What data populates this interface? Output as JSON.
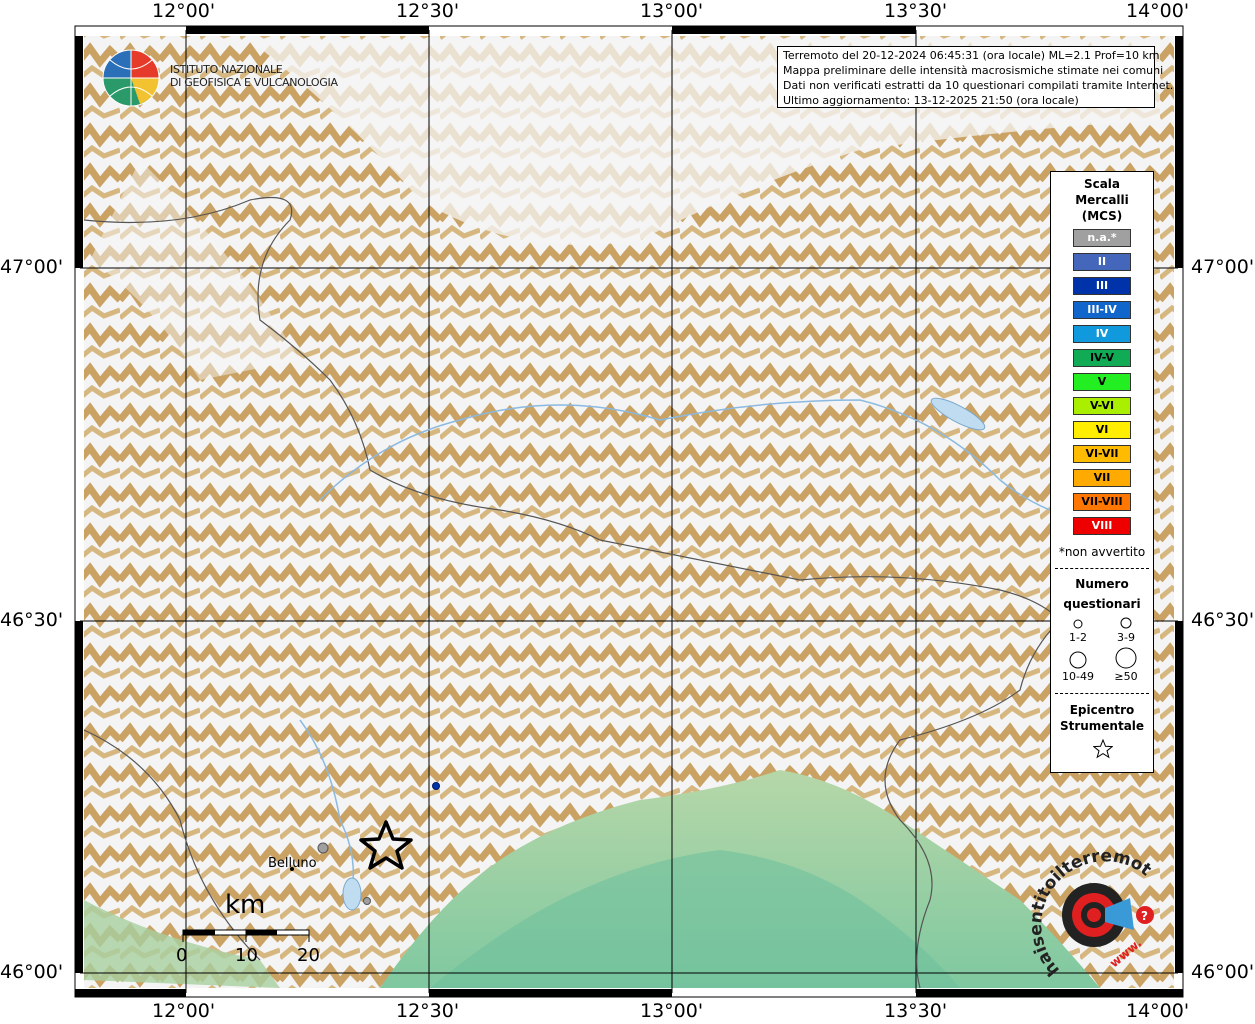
{
  "map": {
    "lon_ticks": [
      "12°00'",
      "12°30'",
      "13°00'",
      "13°30'",
      "14°00'"
    ],
    "lat_ticks": [
      "47°00'",
      "46°30'",
      "46°00'"
    ],
    "place_label": "Belluno"
  },
  "logo": {
    "line1": "ISTITUTO NAZIONALE",
    "line2": "DI GEOFISICA E VULCANOLOGIA"
  },
  "info": {
    "line1": "Terremoto del 20-12-2024 06:45:31 (ora locale) ML=2.1 Prof=10 km",
    "line2": "Mappa preliminare delle intensità macrosismiche stimate nei comuni",
    "line3": "Dati non verificati estratti da 10 questionari compilati tramite Internet.",
    "line4": "Ultimo aggiornamento: 13-12-2025 21:50 (ora locale)"
  },
  "legend": {
    "title1": "Scala",
    "title2": "Mercalli",
    "title3": "(MCS)",
    "intensities": [
      {
        "label": "n.a.*",
        "color": "#a0a0a0",
        "text": "#ffffff"
      },
      {
        "label": "II",
        "color": "#4466bb",
        "text": "#ffffff"
      },
      {
        "label": "III",
        "color": "#0033aa",
        "text": "#ffffff"
      },
      {
        "label": "III-IV",
        "color": "#1166cc",
        "text": "#ffffff"
      },
      {
        "label": "IV",
        "color": "#1199dd",
        "text": "#ffffff"
      },
      {
        "label": "IV-V",
        "color": "#11aa55",
        "text": "#000000"
      },
      {
        "label": "V",
        "color": "#22ee22",
        "text": "#000000"
      },
      {
        "label": "V-VI",
        "color": "#aaee00",
        "text": "#000000"
      },
      {
        "label": "VI",
        "color": "#ffee00",
        "text": "#000000"
      },
      {
        "label": "VI-VII",
        "color": "#ffbb00",
        "text": "#000000"
      },
      {
        "label": "VII",
        "color": "#ffaa00",
        "text": "#000000"
      },
      {
        "label": "VII-VIII",
        "color": "#ff7700",
        "text": "#000000"
      },
      {
        "label": "VIII",
        "color": "#ee0000",
        "text": "#ffffff"
      }
    ],
    "note": "*non avvertito",
    "count_title1": "Numero",
    "count_title2": "questionari",
    "counts": [
      "1-2",
      "3-9",
      "10-49",
      "≥50"
    ],
    "epi_title1": "Epicentro",
    "epi_title2": "Strumentale"
  },
  "scalebar": {
    "unit": "km",
    "labels": [
      "0",
      "10",
      "20"
    ]
  },
  "markers": [
    {
      "type": "intensity-point",
      "intensity": "III",
      "color": "#0033aa"
    },
    {
      "type": "intensity-point",
      "intensity": "n.a.*",
      "color": "#a0a0a0"
    },
    {
      "type": "intensity-point",
      "intensity": "n.a.*",
      "color": "#a0a0a0"
    }
  ],
  "haisentito": {
    "text": "haisentitoilterremoto.it",
    "www": "www."
  }
}
